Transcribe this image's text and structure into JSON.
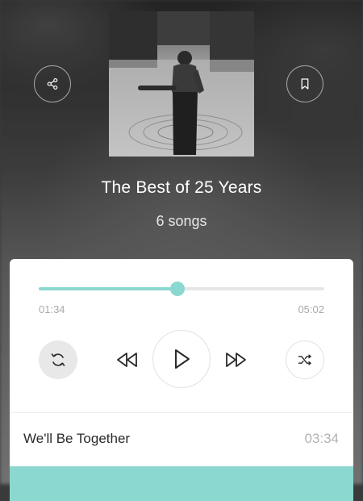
{
  "album": {
    "title": "The Best of 25 Years",
    "song_count": "6 songs"
  },
  "header": {
    "share_icon": "share-icon",
    "bookmark_icon": "bookmark-icon"
  },
  "player": {
    "elapsed": "01:34",
    "total": "05:02",
    "progress_fraction": 0.485,
    "accent_color": "#8ad8cf",
    "controls": [
      "repeat-icon",
      "rewind-icon",
      "play-icon",
      "fast-forward-icon",
      "shuffle-icon"
    ]
  },
  "track": {
    "title": "We'll Be Together",
    "duration": "03:34"
  }
}
